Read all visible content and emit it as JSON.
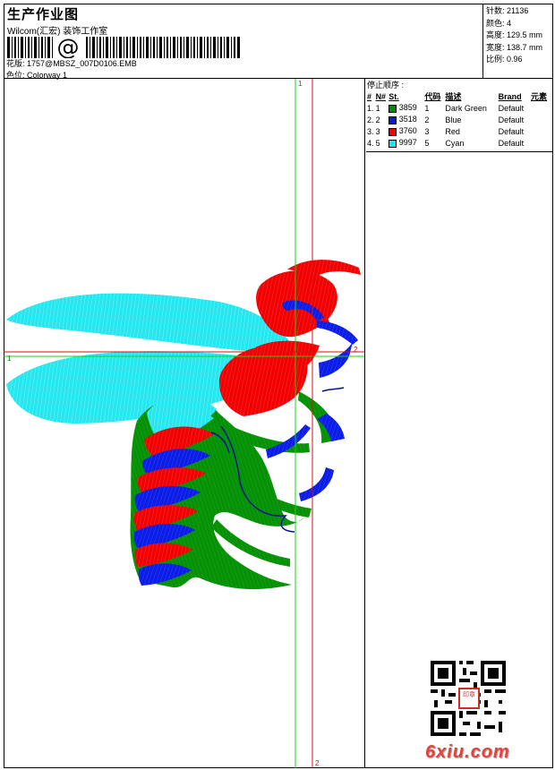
{
  "header": {
    "title": "生产作业图",
    "company": "Wilcom(汇宏) 装饰工作室",
    "barcode_symbol": "@",
    "file_label": "花版:",
    "file_name": "1757@MBSZ_007D0106.EMB",
    "colorway_label": "色位:",
    "colorway_name": "Colorway 1"
  },
  "stats": [
    {
      "label": "针数",
      "value": "21136"
    },
    {
      "label": "颜色",
      "value": "4"
    },
    {
      "label": "高度",
      "value": "129.5 mm"
    },
    {
      "label": "宽度",
      "value": "138.7 mm"
    },
    {
      "label": "比例",
      "value": "0.96"
    }
  ],
  "stop_sequence": {
    "title": "停止顺序 :",
    "columns": [
      "#",
      "N#",
      "St.",
      "代码",
      "描述",
      "Brand",
      "元素"
    ],
    "rows": [
      {
        "index": "1.",
        "n": "1",
        "code": "3859",
        "number": "1",
        "desc": "Dark Green",
        "brand": "Default",
        "color": "#008c00"
      },
      {
        "index": "2.",
        "n": "2",
        "code": "3518",
        "number": "2",
        "desc": "Blue",
        "brand": "Default",
        "color": "#0019e6"
      },
      {
        "index": "3.",
        "n": "3",
        "code": "3760",
        "number": "3",
        "desc": "Red",
        "brand": "Default",
        "color": "#f00000"
      },
      {
        "index": "4.",
        "n": "5",
        "code": "9997",
        "number": "5",
        "desc": "Cyan",
        "brand": "Default",
        "color": "#19e6ef"
      }
    ]
  },
  "guides": {
    "green_top": "1",
    "green_left": "1",
    "red_right": "2",
    "red_bottom": "2"
  },
  "design": {
    "colors": {
      "green": "#078f07",
      "blue": "#0b1ce6",
      "red": "#f20000",
      "cyan": "#25e7ef",
      "green_guide": "#14d314",
      "red_guide": "#d31212"
    }
  },
  "watermark": {
    "seal_text": "印章",
    "site": "6xiu.com"
  }
}
